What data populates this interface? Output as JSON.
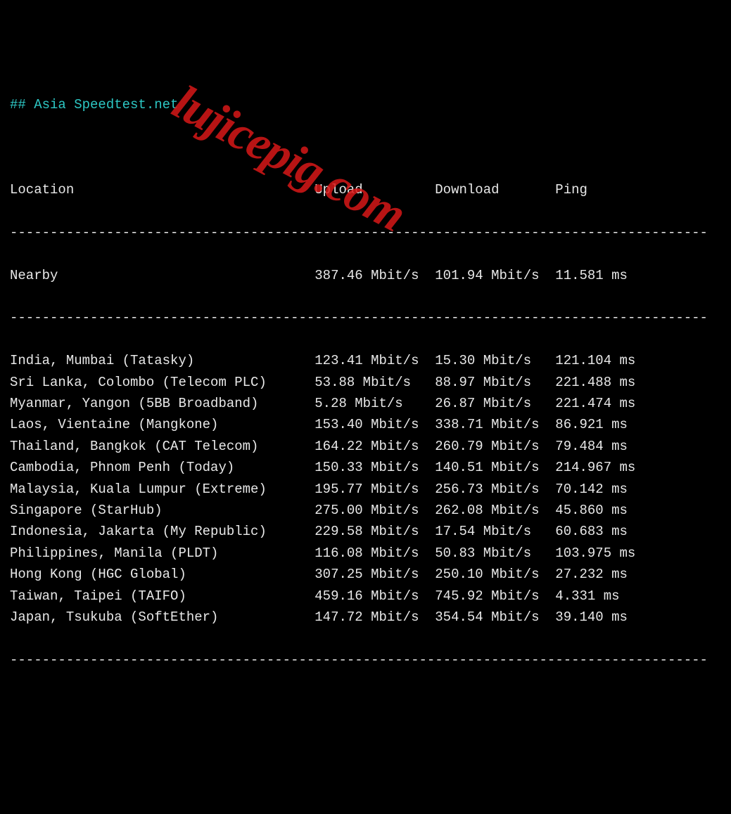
{
  "title": "## Asia Speedtest.net",
  "headers": {
    "location": "Location",
    "upload": "Upload",
    "download": "Download",
    "ping": "Ping"
  },
  "dash": "---------------------------------------------------------------------------------------",
  "nearby": {
    "location": "Nearby",
    "upload": "387.46 Mbit/s",
    "download": "101.94 Mbit/s",
    "ping": "11.581 ms"
  },
  "rows": [
    {
      "location": "India, Mumbai (Tatasky)",
      "upload": "123.41 Mbit/s",
      "download": "15.30 Mbit/s",
      "ping": "121.104 ms"
    },
    {
      "location": "Sri Lanka, Colombo (Telecom PLC)",
      "upload": "53.88 Mbit/s",
      "download": "88.97 Mbit/s",
      "ping": "221.488 ms"
    },
    {
      "location": "Myanmar, Yangon (5BB Broadband)",
      "upload": "5.28 Mbit/s",
      "download": "26.87 Mbit/s",
      "ping": "221.474 ms"
    },
    {
      "location": "Laos, Vientaine (Mangkone)",
      "upload": "153.40 Mbit/s",
      "download": "338.71 Mbit/s",
      "ping": "86.921 ms"
    },
    {
      "location": "Thailand, Bangkok (CAT Telecom)",
      "upload": "164.22 Mbit/s",
      "download": "260.79 Mbit/s",
      "ping": "79.484 ms"
    },
    {
      "location": "Cambodia, Phnom Penh (Today)",
      "upload": "150.33 Mbit/s",
      "download": "140.51 Mbit/s",
      "ping": "214.967 ms"
    },
    {
      "location": "Malaysia, Kuala Lumpur (Extreme)",
      "upload": "195.77 Mbit/s",
      "download": "256.73 Mbit/s",
      "ping": "70.142 ms"
    },
    {
      "location": "Singapore (StarHub)",
      "upload": "275.00 Mbit/s",
      "download": "262.08 Mbit/s",
      "ping": "45.860 ms"
    },
    {
      "location": "Indonesia, Jakarta (My Republic)",
      "upload": "229.58 Mbit/s",
      "download": "17.54 Mbit/s",
      "ping": "60.683 ms"
    },
    {
      "location": "Philippines, Manila (PLDT)",
      "upload": "116.08 Mbit/s",
      "download": "50.83 Mbit/s",
      "ping": "103.975 ms"
    },
    {
      "location": "Hong Kong (HGC Global)",
      "upload": "307.25 Mbit/s",
      "download": "250.10 Mbit/s",
      "ping": "27.232 ms"
    },
    {
      "location": "Taiwan, Taipei (TAIFO)",
      "upload": "459.16 Mbit/s",
      "download": "745.92 Mbit/s",
      "ping": "4.331 ms"
    },
    {
      "location": "Japan, Tsukuba (SoftEther)",
      "upload": "147.72 Mbit/s",
      "download": "354.54 Mbit/s",
      "ping": "39.140 ms"
    }
  ],
  "watermark": "lujicepig.com"
}
